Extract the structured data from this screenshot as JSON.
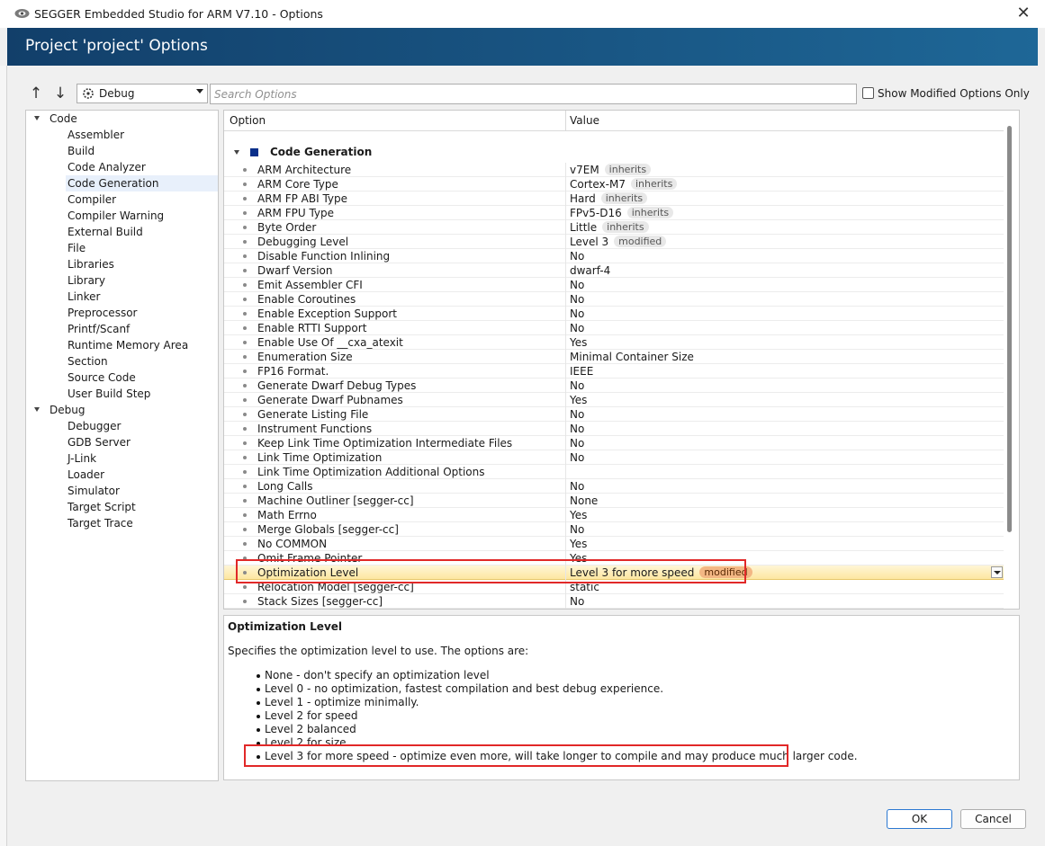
{
  "window": {
    "title": "SEGGER Embedded Studio for ARM V7.10 - Options",
    "close_glyph": "✕"
  },
  "header": {
    "title": "Project 'project' Options"
  },
  "toolbar": {
    "up_glyph": "↑",
    "down_glyph": "↓",
    "configuration": "Debug",
    "search_placeholder": "Search Options",
    "show_modified_label": "Show Modified Options Only",
    "show_modified_checked": false
  },
  "tree": {
    "groups": [
      {
        "label": "Code",
        "items": [
          "Assembler",
          "Build",
          "Code Analyzer",
          "Code Generation",
          "Compiler",
          "Compiler Warning",
          "External Build",
          "File",
          "Libraries",
          "Library",
          "Linker",
          "Preprocessor",
          "Printf/Scanf",
          "Runtime Memory Area",
          "Section",
          "Source Code",
          "User Build Step"
        ]
      },
      {
        "label": "Debug",
        "items": [
          "Debugger",
          "GDB Server",
          "J-Link",
          "Loader",
          "Simulator",
          "Target Script",
          "Target Trace"
        ]
      }
    ],
    "selected": "Code Generation"
  },
  "grid": {
    "col_option": "Option",
    "col_value": "Value",
    "section": "Code Generation",
    "rows": [
      {
        "name": "ARM Architecture",
        "value": "v7EM",
        "tag": "inherits"
      },
      {
        "name": "ARM Core Type",
        "value": "Cortex-M7",
        "tag": "inherits"
      },
      {
        "name": "ARM FP ABI Type",
        "value": "Hard",
        "tag": "inherits"
      },
      {
        "name": "ARM FPU Type",
        "value": "FPv5-D16",
        "tag": "inherits"
      },
      {
        "name": "Byte Order",
        "value": "Little",
        "tag": "inherits"
      },
      {
        "name": "Debugging Level",
        "value": "Level 3",
        "tag": "modified"
      },
      {
        "name": "Disable Function Inlining",
        "value": "No",
        "tag": ""
      },
      {
        "name": "Dwarf Version",
        "value": "dwarf-4",
        "tag": ""
      },
      {
        "name": "Emit Assembler CFI",
        "value": "No",
        "tag": ""
      },
      {
        "name": "Enable Coroutines",
        "value": "No",
        "tag": ""
      },
      {
        "name": "Enable Exception Support",
        "value": "No",
        "tag": ""
      },
      {
        "name": "Enable RTTI Support",
        "value": "No",
        "tag": ""
      },
      {
        "name": "Enable Use Of __cxa_atexit",
        "value": "Yes",
        "tag": ""
      },
      {
        "name": "Enumeration Size",
        "value": "Minimal Container Size",
        "tag": ""
      },
      {
        "name": "FP16 Format.",
        "value": "IEEE",
        "tag": ""
      },
      {
        "name": "Generate Dwarf Debug Types",
        "value": "No",
        "tag": ""
      },
      {
        "name": "Generate Dwarf Pubnames",
        "value": "Yes",
        "tag": ""
      },
      {
        "name": "Generate Listing File",
        "value": "No",
        "tag": ""
      },
      {
        "name": "Instrument Functions",
        "value": "No",
        "tag": ""
      },
      {
        "name": "Keep Link Time Optimization Intermediate Files",
        "value": "No",
        "tag": ""
      },
      {
        "name": "Link Time Optimization",
        "value": "No",
        "tag": ""
      },
      {
        "name": "Link Time Optimization Additional Options",
        "value": "",
        "tag": ""
      },
      {
        "name": "Long Calls",
        "value": "No",
        "tag": ""
      },
      {
        "name": "Machine Outliner [segger-cc]",
        "value": "None",
        "tag": ""
      },
      {
        "name": "Math Errno",
        "value": "Yes",
        "tag": ""
      },
      {
        "name": "Merge Globals [segger-cc]",
        "value": "No",
        "tag": ""
      },
      {
        "name": "No COMMON",
        "value": "Yes",
        "tag": ""
      },
      {
        "name": "Omit Frame Pointer",
        "value": "Yes",
        "tag": ""
      },
      {
        "name": "Optimization Level",
        "value": "Level 3 for more speed",
        "tag": "modified",
        "highlight": true
      },
      {
        "name": "Relocation Model [segger-cc]",
        "value": "static",
        "tag": ""
      },
      {
        "name": "Stack Sizes [segger-cc]",
        "value": "No",
        "tag": ""
      }
    ]
  },
  "help": {
    "title": "Optimization Level",
    "description": "Specifies the optimization level to use. The options are:",
    "items": [
      "None - don't specify an optimization level",
      "Level 0 - no optimization, fastest compilation and best debug experience.",
      "Level 1 - optimize minimally.",
      "Level 2 for speed",
      "Level 2 balanced",
      "Level 2 for size",
      "Level 3 for more speed - optimize even more, will take longer to compile and may produce much larger code."
    ]
  },
  "buttons": {
    "ok": "OK",
    "cancel": "Cancel"
  },
  "colors": {
    "header_start": "#123f6a",
    "header_end": "#1e6797",
    "highlight_box": "#e12828",
    "modified_tag": "#f3b784"
  }
}
